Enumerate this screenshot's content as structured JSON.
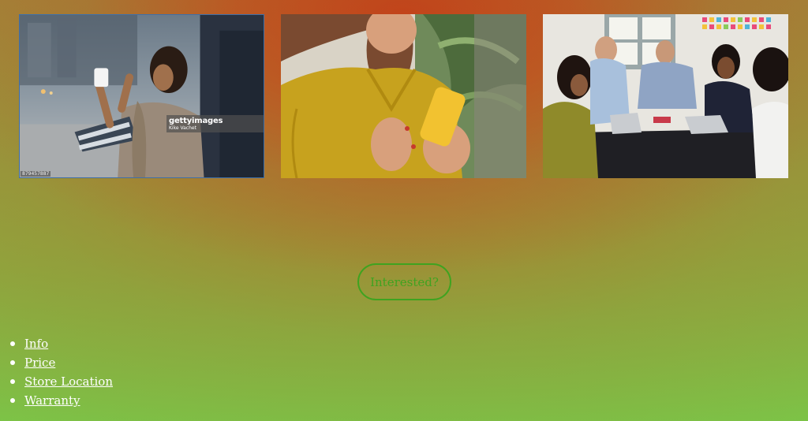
{
  "gallery": {
    "images": [
      {
        "name": "woman-taking-photo-on-street",
        "badge_brand": "gettyimages",
        "badge_credit": "Kike Vachet",
        "stock_id": "879457887"
      },
      {
        "name": "woman-holding-yellow-phone"
      },
      {
        "name": "team-meeting-at-table"
      }
    ]
  },
  "cta": {
    "label": "Interested?"
  },
  "footer": {
    "links": [
      {
        "label": "Info"
      },
      {
        "label": "Price"
      },
      {
        "label": "Store Location"
      },
      {
        "label": "Warranty"
      }
    ]
  },
  "colors": {
    "cta_accent": "#3fa320",
    "link_color": "#ffffff",
    "background_top": "#ce2c10",
    "background_bottom": "#7cc447"
  }
}
